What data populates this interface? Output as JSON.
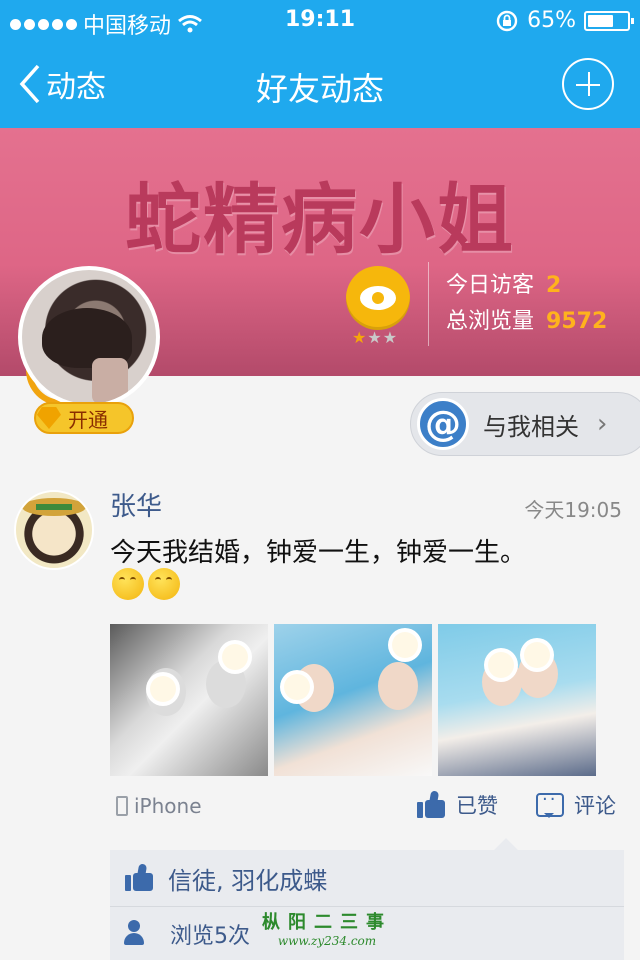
{
  "status_bar": {
    "carrier": "中国移动",
    "time": "19:11",
    "battery": "65%",
    "battery_level": 0.65,
    "icons": [
      "signal-dots-icon",
      "wifi-icon",
      "rotation-lock-icon",
      "battery-icon"
    ]
  },
  "nav": {
    "back_label": "动态",
    "title": "好友动态",
    "add_icon": "plus-icon"
  },
  "cover": {
    "title": "蛇精病小姐",
    "level_stars": 1,
    "level_stars_total": 3,
    "visitors_today_label": "今日访客",
    "visitors_today": "2",
    "total_views_label": "总浏览量",
    "total_views": "9572"
  },
  "vip": {
    "label": "开通"
  },
  "about_me": {
    "label": "与我相关"
  },
  "post": {
    "user": "张华",
    "time": "今天19:05",
    "text": "今天我结婚，钟爱一生，钟爱一生。",
    "emoji_count": 2,
    "photo_count": 3,
    "device": "iPhone",
    "like_label": "已赞",
    "comment_label": "评论",
    "likers": "信徒, 羽化成蝶",
    "views": "浏览5次"
  },
  "watermark": {
    "text": "枞阳二三事",
    "url": "www.zy234.com"
  },
  "colors": {
    "header_blue": "#1fa9ee",
    "cover_pink": "#de6686",
    "link_blue": "#3d5a8b",
    "accent_orange": "#ffb21d"
  }
}
